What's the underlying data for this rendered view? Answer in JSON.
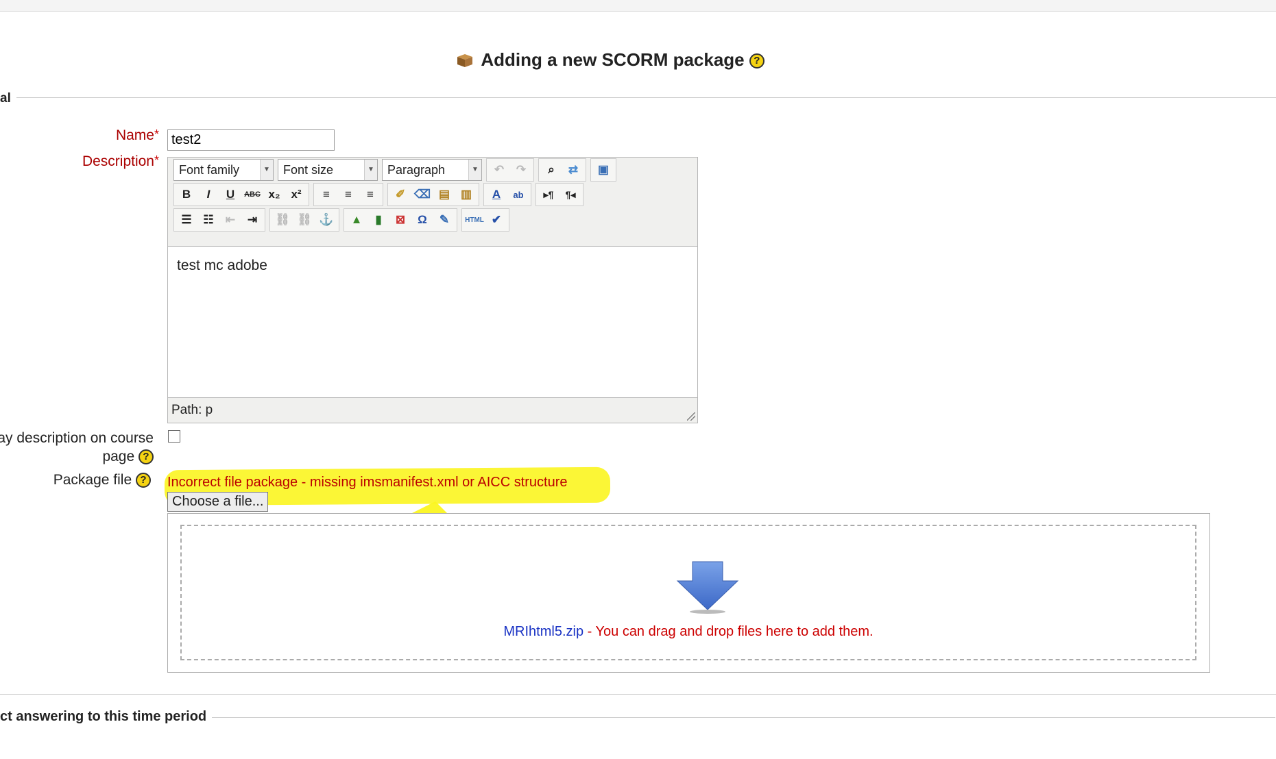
{
  "page": {
    "title": "Adding a new SCORM package",
    "help_icon": "?"
  },
  "section_general": {
    "legend": "al"
  },
  "form": {
    "name_label": "Name",
    "name_value": "test2",
    "description_label": "Description",
    "required_marker": "*",
    "editor": {
      "font_family": "Font family",
      "font_size": "Font size",
      "format": "Paragraph",
      "content": "test mc adobe",
      "path": "Path: p"
    },
    "display_desc_label_line1": "ay description on course",
    "display_desc_label_line2": "page",
    "package_label": "Package file",
    "package_error": "Incorrect file package - missing imsmanifest.xml or AICC structure",
    "choose_button": "Choose a file...",
    "dropzone_file": "MRIhtml5.zip",
    "dropzone_text": " - You can drag and drop files here to add them."
  },
  "section_next": {
    "legend": "ct answering to this time period"
  },
  "colors": {
    "error": "#b00000",
    "highlight": "#fbf520",
    "link": "#1a33c4",
    "help": "#f5d312"
  }
}
